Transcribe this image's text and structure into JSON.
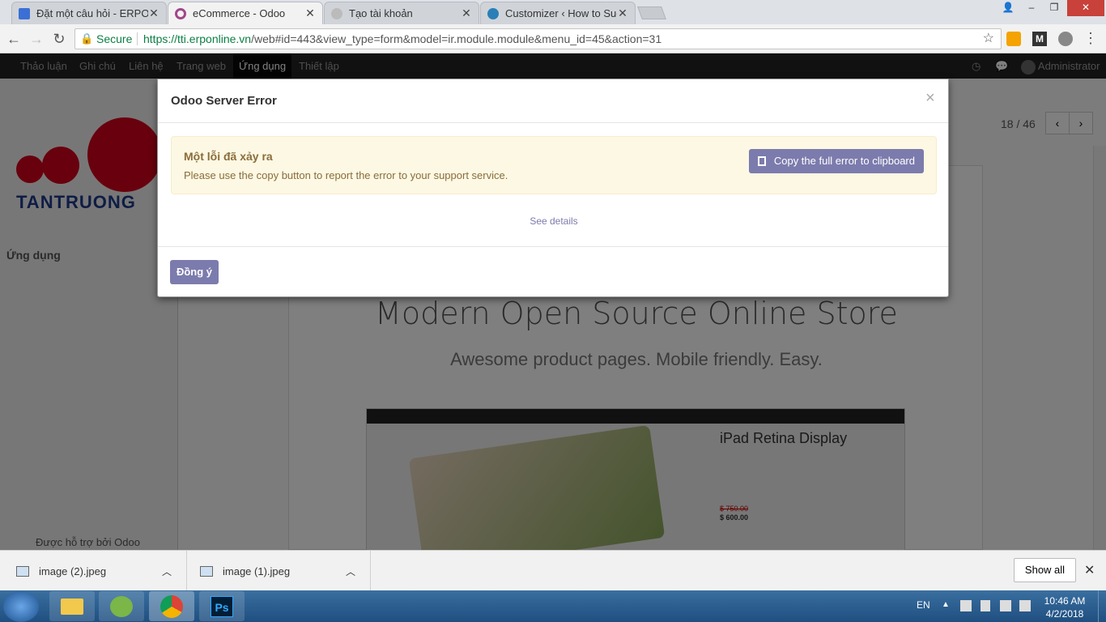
{
  "browser": {
    "tabs": [
      {
        "title": "Đặt một câu hỏi - ERPOn",
        "active": false
      },
      {
        "title": "eCommerce - Odoo",
        "active": true
      },
      {
        "title": "Tạo tài khoản",
        "active": false
      },
      {
        "title": "Customizer ‹ How to Suc",
        "active": false
      }
    ],
    "secure_label": "Secure",
    "url_host": "https://tti.erponline.vn",
    "url_path": "/web#id=443&view_type=form&model=ir.module.module&menu_id=45&action=31",
    "window_controls": {
      "minimize": "–",
      "restore": "❐",
      "close": "✕"
    }
  },
  "odoo_nav": {
    "menus": [
      "Thảo luận",
      "Ghi chú",
      "Liên hệ",
      "Trang web",
      "Ứng dụng",
      "Thiết lập"
    ],
    "active_index": 4,
    "user": "Administrator"
  },
  "sidebar": {
    "logo_text": "TANTRUONG",
    "heading": "Ứng dụng",
    "powered_by": "Được hỗ trợ bởi Odoo"
  },
  "pager": {
    "value": "18 / 46"
  },
  "background_page": {
    "headline": "Modern Open Source Online Store",
    "subheadline": "Awesome product pages. Mobile friendly. Easy.",
    "product_title": "iPad Retina Display",
    "old_price": "$ 750.00",
    "new_price": "$ 600.00"
  },
  "modal": {
    "title": "Odoo Server Error",
    "close": "×",
    "alert_title": "Một lỗi đã xảy ra",
    "alert_text": "Please use the copy button to report the error to your support service.",
    "copy_button": "Copy the full error to clipboard",
    "see_details": "See details",
    "ok_button": "Đồng ý"
  },
  "downloads": {
    "items": [
      "image (2).jpeg",
      "image (1).jpeg"
    ],
    "show_all": "Show all"
  },
  "taskbar": {
    "lang": "EN",
    "time": "10:46 AM",
    "date": "4/2/2018"
  },
  "colors": {
    "odoo_primary": "#7c7bad",
    "nav_bg": "#222222",
    "alert_bg": "#fcf8e3"
  }
}
